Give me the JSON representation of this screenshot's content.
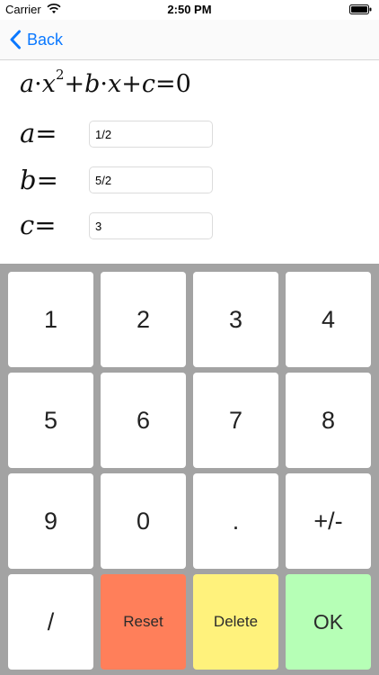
{
  "status_bar": {
    "carrier": "Carrier",
    "time": "2:50 PM",
    "icons": [
      "wifi-icon",
      "battery-icon"
    ]
  },
  "nav": {
    "back_label": "Back",
    "accent_color": "#0a78ff"
  },
  "equation": {
    "a": "a",
    "dot1": "·",
    "x1": "x",
    "exp": "2",
    "plus1": "+",
    "b": "b",
    "dot2": "·",
    "x2": "x",
    "plus2": "+",
    "c": "c",
    "equals": "=",
    "rhs": "0"
  },
  "fields": [
    {
      "var": "a",
      "eq": "=",
      "value": "1/2"
    },
    {
      "var": "b",
      "eq": "=",
      "value": "5/2"
    },
    {
      "var": "c",
      "eq": "=",
      "value": "3"
    }
  ],
  "keypad": {
    "keys": [
      {
        "label": "1"
      },
      {
        "label": "2"
      },
      {
        "label": "3"
      },
      {
        "label": "4"
      },
      {
        "label": "5"
      },
      {
        "label": "6"
      },
      {
        "label": "7"
      },
      {
        "label": "8"
      },
      {
        "label": "9"
      },
      {
        "label": "0"
      },
      {
        "label": "."
      },
      {
        "label": "+/-"
      },
      {
        "label": "/"
      },
      {
        "label": "Reset"
      },
      {
        "label": "Delete"
      },
      {
        "label": "OK"
      }
    ],
    "colors": {
      "background": "#a3a3a3",
      "key": "#ffffff",
      "reset": "#ff7f5a",
      "delete": "#fff27c",
      "ok": "#b6ffb6"
    }
  }
}
